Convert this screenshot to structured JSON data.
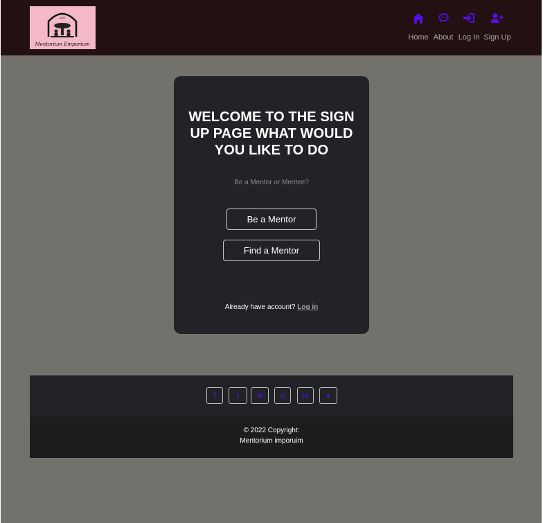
{
  "brand": {
    "logo_text": "Mentorium Emporium",
    "logo_est": "EST.",
    "logo_year": "2022"
  },
  "nav": {
    "items": [
      {
        "label": "Home",
        "icon": "house-icon"
      },
      {
        "label": "About",
        "icon": "chat-bubble-icon"
      },
      {
        "label": "Log In",
        "icon": "sign-in-icon"
      },
      {
        "label": "Sign Up",
        "icon": "user-plus-icon"
      }
    ]
  },
  "signup": {
    "title": "WELCOME TO THE SIGN UP PAGE WHAT WOULD YOU LIKE TO DO",
    "subtitle": "Be a Mentor or Mentee?",
    "be_mentor_label": "Be a Mentor",
    "find_mentor_label": "Find a Mentor",
    "account_prompt": "Already have account?",
    "login_link": "Log in"
  },
  "footer": {
    "social": [
      {
        "name": "facebook-icon",
        "glyph": "f"
      },
      {
        "name": "twitter-icon",
        "glyph": "t"
      },
      {
        "name": "google-icon",
        "glyph": "G"
      },
      {
        "name": "instagram-icon",
        "glyph": "◎"
      },
      {
        "name": "linkedin-icon",
        "glyph": "in"
      },
      {
        "name": "github-icon",
        "glyph": "●"
      }
    ],
    "copyright_line1": "© 2022 Copyright:",
    "copyright_line2": "Mentorium imporuim"
  },
  "colors": {
    "accent": "#5310e0",
    "navbar_bg": "#231012",
    "page_bg": "#73716c",
    "card_bg": "#212327"
  }
}
